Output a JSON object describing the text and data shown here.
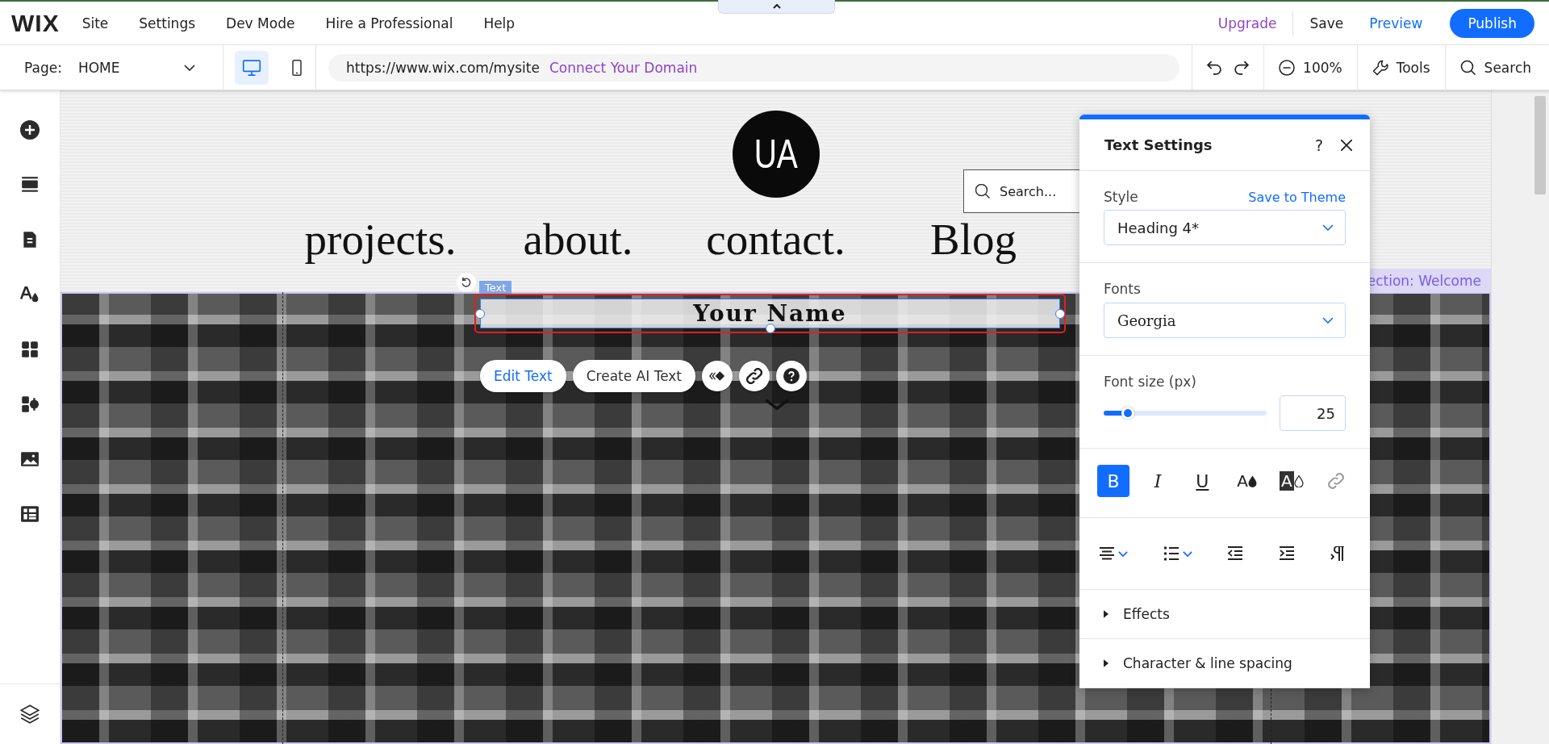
{
  "top_bar": {
    "logo": "WIX",
    "menu": [
      "Site",
      "Settings",
      "Dev Mode",
      "Hire a Professional",
      "Help"
    ],
    "upgrade": "Upgrade",
    "save": "Save",
    "preview": "Preview",
    "publish": "Publish"
  },
  "toolbar": {
    "page_label": "Page:",
    "page": "HOME",
    "devices": [
      {
        "kind": "desktop",
        "selected": true
      },
      {
        "kind": "mobile",
        "selected": false
      }
    ],
    "url": "https://www.wix.com/mysite",
    "connect_domain": "Connect Your Domain",
    "zoom": "100%",
    "tools": "Tools",
    "search": "Search"
  },
  "sidebar": {
    "items": [
      {
        "kind": "add"
      },
      {
        "kind": "sections"
      },
      {
        "kind": "pages"
      },
      {
        "kind": "design"
      },
      {
        "kind": "apps"
      },
      {
        "kind": "business"
      },
      {
        "kind": "media"
      },
      {
        "kind": "cms"
      }
    ],
    "bottom": {
      "kind": "layers"
    }
  },
  "site": {
    "logo": "UA",
    "search_placeholder": "Search...",
    "nav": [
      "projects.",
      "about.",
      "contact.",
      "Blog"
    ],
    "section_label": "ection: Welcome",
    "selected_tag": "Text",
    "selected_text": "Your Name",
    "actions": [
      {
        "kind": "primary",
        "label": "Edit Text"
      },
      {
        "kind": "plain",
        "label": "Create AI Text"
      }
    ],
    "action_icons": [
      {
        "kind": "animation"
      },
      {
        "kind": "link"
      },
      {
        "kind": "help"
      }
    ]
  },
  "panel": {
    "title": "Text Settings",
    "help": "?",
    "style_label": "Style",
    "save_to_theme": "Save to Theme",
    "style_value": "Heading 4*",
    "fonts_label": "Fonts",
    "font_value": "Georgia",
    "size_label": "Font size (px)",
    "size": {
      "level": 0.15,
      "value": "25"
    },
    "format": [
      {
        "kind": "bold",
        "label": "B",
        "selected": true
      },
      {
        "kind": "italic",
        "label": "I",
        "selected": false
      },
      {
        "kind": "underline",
        "label": "U",
        "selected": false
      },
      {
        "kind": "text-color",
        "label": "A",
        "selected": false
      },
      {
        "kind": "highlight",
        "label": "A",
        "selected": false
      },
      {
        "kind": "link",
        "selected": false
      }
    ],
    "paragraph": [
      {
        "kind": "align"
      },
      {
        "kind": "list"
      },
      {
        "kind": "outdent"
      },
      {
        "kind": "indent"
      },
      {
        "kind": "direction"
      }
    ],
    "sections": [
      {
        "label": "Effects",
        "expanded": false
      },
      {
        "label": "Character & line spacing",
        "expanded": false
      }
    ]
  }
}
